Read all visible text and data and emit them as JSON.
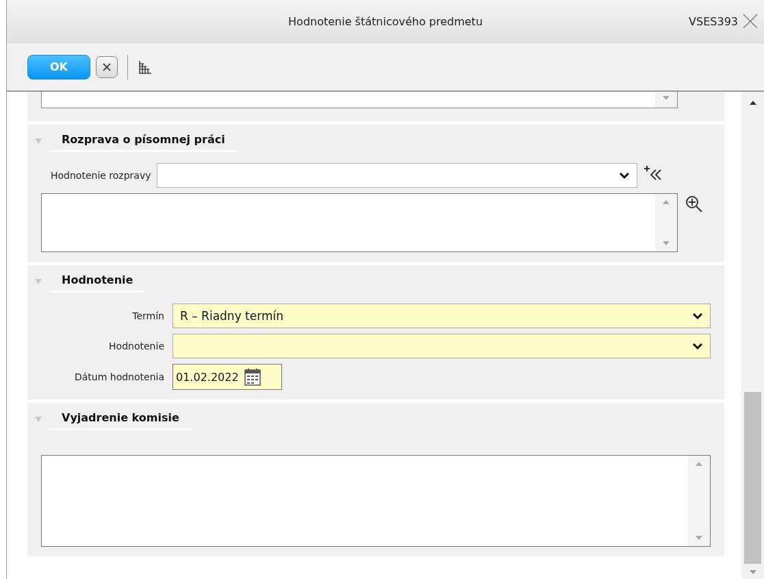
{
  "window": {
    "title": "Hodnotenie štátnicového predmetu",
    "code": "VSES393"
  },
  "toolbar": [
    {
      "kind": "ok",
      "label": "OK"
    },
    {
      "kind": "cancel"
    },
    {
      "kind": "tree"
    }
  ],
  "top_field": {
    "kind": "textarea"
  },
  "sections": [
    {
      "title": "Rozprava o písomnej práci",
      "expanded": true,
      "kind": "wide",
      "fields": [
        {
          "kind": "select",
          "label": "Hodnotenie rozpravy",
          "required": false,
          "actions": [
            {
              "kind": "add"
            }
          ]
        },
        {
          "kind": "textarea",
          "actions": [
            {
              "kind": "zoom"
            }
          ]
        }
      ]
    },
    {
      "title": "Hodnotenie",
      "expanded": true,
      "kind": "form",
      "fields": [
        {
          "kind": "select",
          "label": "Termín",
          "value": "R – Riadny termín",
          "required": true
        },
        {
          "kind": "select",
          "label": "Hodnotenie",
          "required": true
        },
        {
          "kind": "date",
          "label": "Dátum hodnotenia",
          "value": "01.02.2022",
          "required": true
        }
      ]
    },
    {
      "title": "Vyjadrenie komisie",
      "expanded": true,
      "kind": "full",
      "fields": [
        {
          "kind": "textarea"
        }
      ]
    }
  ]
}
